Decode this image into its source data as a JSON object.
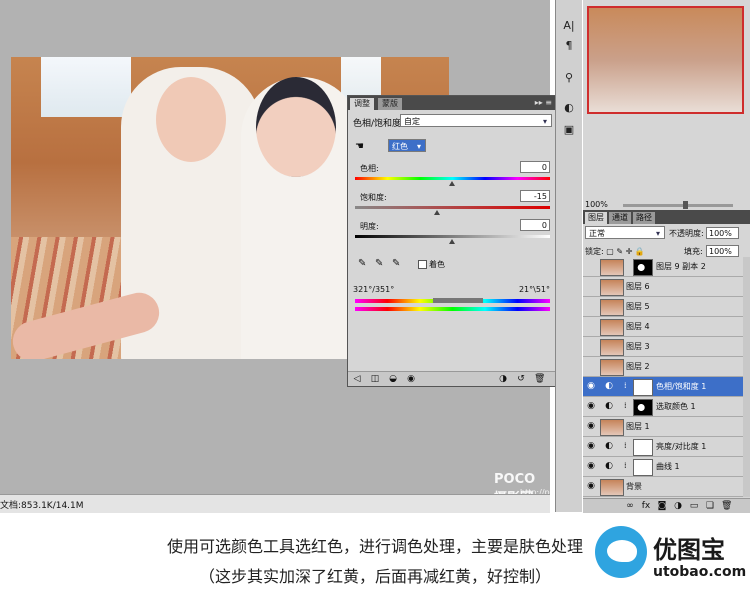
{
  "status": {
    "doc_info": "文档:853.1K/14.1M"
  },
  "watermark": {
    "brand": "POCO 摄影网",
    "url": "http://photo.poco.cn"
  },
  "adjustments": {
    "tabs": [
      "调整",
      "蒙版"
    ],
    "title": "色相/饱和度",
    "preset": "自定",
    "channel": "红色",
    "hue": {
      "label": "色相:",
      "value": "0"
    },
    "saturation": {
      "label": "饱和度:",
      "value": "-15"
    },
    "lightness": {
      "label": "明度:",
      "value": "0"
    },
    "colorize_label": "着色",
    "range_left": "321°/351°",
    "range_right": "21°\\51°"
  },
  "navigator": {
    "zoom": "100%"
  },
  "layers_panel": {
    "tabs": [
      "图层",
      "通道",
      "路径"
    ],
    "blend_mode": "正常",
    "opacity_label": "不透明度:",
    "opacity": "100%",
    "lock_label": "锁定:",
    "fill_label": "填充:",
    "fill": "100%",
    "layers": [
      {
        "name": "图层 9 副本 2",
        "visible": false,
        "kind": "image-mask"
      },
      {
        "name": "图层 6",
        "visible": false,
        "kind": "image"
      },
      {
        "name": "图层 5",
        "visible": false,
        "kind": "image"
      },
      {
        "name": "图层 4",
        "visible": false,
        "kind": "image"
      },
      {
        "name": "图层 3",
        "visible": false,
        "kind": "image"
      },
      {
        "name": "图层 2",
        "visible": false,
        "kind": "image"
      },
      {
        "name": "色相/饱和度 1",
        "visible": true,
        "kind": "adjustment",
        "selected": true
      },
      {
        "name": "选取颜色 1",
        "visible": true,
        "kind": "adjustment-dark"
      },
      {
        "name": "图层 1",
        "visible": true,
        "kind": "image"
      },
      {
        "name": "亮度/对比度 1",
        "visible": true,
        "kind": "adjustment"
      },
      {
        "name": "曲线 1",
        "visible": true,
        "kind": "adjustment"
      },
      {
        "name": "背景",
        "visible": true,
        "kind": "image"
      }
    ]
  },
  "caption": {
    "line1": "使用可选颜色工具选红色，进行调色处理，主要是肤色处理",
    "line2": "（这步其实加深了红黄，后面再减红黄，好控制）"
  },
  "logo": {
    "name": "优图宝",
    "url": "utobao.com"
  },
  "colors": {
    "selection": "#3d6fc8",
    "panel": "#d6d6d6",
    "canvas": "#b2b2b2",
    "accent": "#2fa4e0"
  }
}
